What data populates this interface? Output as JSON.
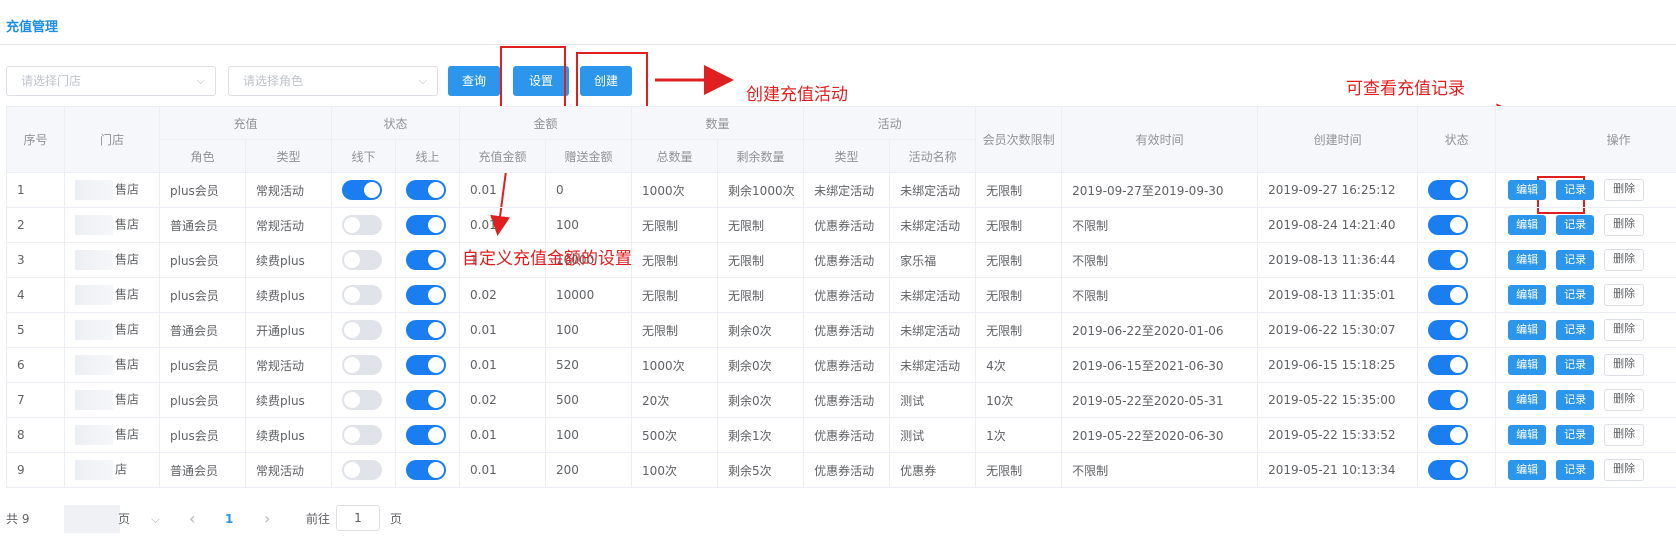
{
  "page": {
    "title": "充值管理"
  },
  "filters": {
    "store_placeholder": "请选择门店",
    "role_placeholder": "请选择角色",
    "query_label": "查询",
    "set_label": "设置",
    "create_label": "创建"
  },
  "annotations": {
    "create": "创建充值活动",
    "records": "可查看充值记录",
    "custom_amount": "自定义充值金额的设置"
  },
  "table": {
    "group_headers": {
      "index": "序号",
      "store": "门店",
      "recharge": "充值",
      "status": "状态",
      "amount": "金额",
      "quantity": "数量",
      "activity": "活动",
      "limit": "会员次数限制",
      "valid": "有效时间",
      "created": "创建时间",
      "state": "状态",
      "ops": "操作"
    },
    "sub_headers": {
      "role": "角色",
      "type": "类型",
      "offline": "线下",
      "online": "线上",
      "recharge_amount": "充值金额",
      "gift_amount": "赠送金额",
      "total": "总数量",
      "remaining": "剩余数量",
      "act_type": "类型",
      "act_name": "活动名称"
    },
    "ops_labels": {
      "edit": "编辑",
      "log": "记录",
      "delete": "删除"
    },
    "rows": [
      {
        "index": "1",
        "store": "售店",
        "role": "plus会员",
        "type": "常规活动",
        "offline": true,
        "online": true,
        "amount": "0.01",
        "gift": "0",
        "total": "1000次",
        "remaining": "剩余1000次",
        "act_type": "未绑定活动",
        "act_name": "未绑定活动",
        "limit": "无限制",
        "valid": "2019-09-27至2019-09-30",
        "created": "2019-09-27 16:25:12",
        "state": true
      },
      {
        "index": "2",
        "store": "售店",
        "role": "普通会员",
        "type": "常规活动",
        "offline": false,
        "online": true,
        "amount": "0.01",
        "gift": "100",
        "total": "无限制",
        "remaining": "无限制",
        "act_type": "优惠券活动",
        "act_name": "未绑定活动",
        "limit": "无限制",
        "valid": "不限制",
        "created": "2019-08-24 14:21:40",
        "state": true
      },
      {
        "index": "3",
        "store": "售店",
        "role": "plus会员",
        "type": "续费plus",
        "offline": false,
        "online": true,
        "amount": "1",
        "gift": "10000",
        "total": "无限制",
        "remaining": "无限制",
        "act_type": "优惠券活动",
        "act_name": "家乐福",
        "limit": "无限制",
        "valid": "不限制",
        "created": "2019-08-13 11:36:44",
        "state": true
      },
      {
        "index": "4",
        "store": "售店",
        "role": "plus会员",
        "type": "续费plus",
        "offline": false,
        "online": true,
        "amount": "0.02",
        "gift": "10000",
        "total": "无限制",
        "remaining": "无限制",
        "act_type": "优惠券活动",
        "act_name": "未绑定活动",
        "limit": "无限制",
        "valid": "不限制",
        "created": "2019-08-13 11:35:01",
        "state": true
      },
      {
        "index": "5",
        "store": "售店",
        "role": "普通会员",
        "type": "开通plus",
        "offline": false,
        "online": true,
        "amount": "0.01",
        "gift": "100",
        "total": "无限制",
        "remaining": "剩余0次",
        "act_type": "优惠券活动",
        "act_name": "未绑定活动",
        "limit": "无限制",
        "valid": "2019-06-22至2020-01-06",
        "created": "2019-06-22 15:30:07",
        "state": true
      },
      {
        "index": "6",
        "store": "售店",
        "role": "plus会员",
        "type": "常规活动",
        "offline": false,
        "online": true,
        "amount": "0.01",
        "gift": "520",
        "total": "1000次",
        "remaining": "剩余0次",
        "act_type": "优惠券活动",
        "act_name": "未绑定活动",
        "limit": "4次",
        "valid": "2019-06-15至2021-06-30",
        "created": "2019-06-15 15:18:25",
        "state": true
      },
      {
        "index": "7",
        "store": "售店",
        "role": "plus会员",
        "type": "续费plus",
        "offline": false,
        "online": true,
        "amount": "0.02",
        "gift": "500",
        "total": "20次",
        "remaining": "剩余0次",
        "act_type": "优惠券活动",
        "act_name": "测试",
        "limit": "10次",
        "valid": "2019-05-22至2020-05-31",
        "created": "2019-05-22 15:35:00",
        "state": true
      },
      {
        "index": "8",
        "store": "售店",
        "role": "plus会员",
        "type": "续费plus",
        "offline": false,
        "online": true,
        "amount": "0.01",
        "gift": "100",
        "total": "500次",
        "remaining": "剩余1次",
        "act_type": "优惠券活动",
        "act_name": "测试",
        "limit": "1次",
        "valid": "2019-05-22至2020-06-30",
        "created": "2019-05-22 15:33:52",
        "state": true
      },
      {
        "index": "9",
        "store": "店",
        "role": "普通会员",
        "type": "常规活动",
        "offline": false,
        "online": true,
        "amount": "0.01",
        "gift": "200",
        "total": "100次",
        "remaining": "剩余5次",
        "act_type": "优惠券活动",
        "act_name": "优惠券",
        "limit": "无限制",
        "valid": "不限制",
        "created": "2019-05-21 10:13:34",
        "state": true
      }
    ]
  },
  "pagination": {
    "total_prefix": "共 9",
    "page_size_suffix": "页",
    "prev": "‹",
    "current": "1",
    "next": "›",
    "goto_prefix": "前往",
    "goto_value": "1",
    "goto_suffix": "页"
  }
}
